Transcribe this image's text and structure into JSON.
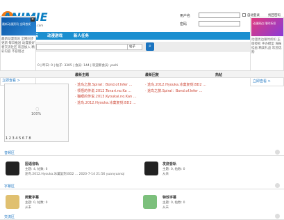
{
  "header": {
    "brand": "ANIMIE",
    "tagline": "www.animie.com",
    "username_label": "用户名",
    "password_label": "密码",
    "remember_label": "自动登录",
    "forgot_label": "找回密码",
    "register_label": "注册"
  },
  "nav": {
    "items": [
      "论坛",
      "动漫游戏",
      "新人任务"
    ]
  },
  "search": {
    "scope": "帖子",
    "button": "搜"
  },
  "stats": {
    "text": "今日: 0 | 昨日: 0 | 帖子: 3305 | 会员: 144 | 欢迎新会员: yoshi"
  },
  "ad_left": {
    "img_text": "最新动漫资讯 全网首发",
    "text": "最新动漫资讯 全网同步更新 每日推送 动漫爱好者交流社区 欢迎加入 精彩内容 不容错过",
    "link": "立即查看 >"
  },
  "ad_right": {
    "img_text": "动漫周边 限时折扣",
    "text": "动漫周边限时折扣 正版授权 手办模型 海报挂画 精美礼品 欢迎选购",
    "link": "立即查看 >"
  },
  "panel": {
    "col1": "最新主题",
    "col2": "最新回复",
    "col3": "热帖",
    "loading": "100%",
    "pages": "1 2 3 4 5 6 7 8",
    "latest_threads": [
      "· 途鸟之旅.Spiral：Bond.of.Infer ...",
      "· 领悟的传说.2012.Tonari.no.Ka ...",
      "· 猫眼的传说.2013.Kyoukai.no.Kan ...",
      "· 途鸟.2012.Hyouka.冰菓复刻.BD2 ..."
    ],
    "latest_replies": [
      "· 途鸟.2012.Hyouka.冰菓复刻.BD2 ...",
      "· 途鸟之旅.Spiral：Bond.of.Infer ..."
    ]
  },
  "sections": [
    {
      "title": "音频区",
      "cards": [
        {
          "title": "国语音轨",
          "meta1": "主题: 4, 帖数: 6",
          "meta2": "途鸟.2012.Hyouka.冰菓复刻.BD2 ... 2020-7-14 21:56 yuanyuanqi"
        },
        {
          "title": "发烧音轨",
          "meta1": "主题: 0, 帖数: 0",
          "meta2": "从未"
        }
      ]
    },
    {
      "title": "字幕区",
      "cards": [
        {
          "title": "简繁字幕",
          "meta1": "主题: 0, 帖数: 0",
          "meta2": "从未"
        },
        {
          "title": "特效字幕",
          "meta1": "主题: 0, 帖数: 0",
          "meta2": "从未"
        }
      ]
    },
    {
      "title": "交流区",
      "cards": []
    }
  ]
}
